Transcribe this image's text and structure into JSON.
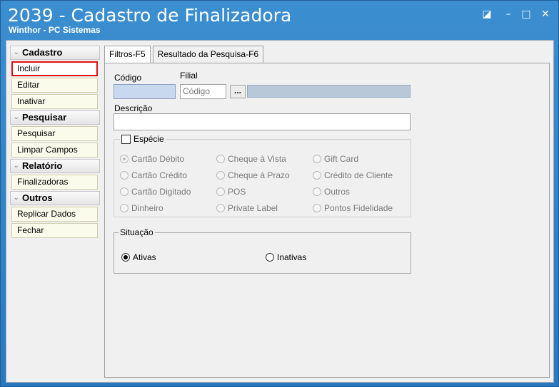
{
  "window": {
    "title": "2039 - Cadastro de Finalizadora",
    "subtitle": "Winthor - PC Sistemas",
    "controls": {
      "restore": "◪",
      "minimize": "–",
      "maximize": "□",
      "close": "✕"
    }
  },
  "menu": {
    "groups": [
      {
        "label": "Cadastro",
        "items": [
          "Incluir",
          "Editar",
          "Inativar"
        ]
      },
      {
        "label": "Pesquisar",
        "items": [
          "Pesquisar",
          "Limpar Campos"
        ]
      },
      {
        "label": "Relatório",
        "items": [
          "Finalizadoras"
        ]
      },
      {
        "label": "Outros",
        "items": [
          "Replicar Dados",
          "Fechar"
        ]
      }
    ],
    "selected": "Incluir"
  },
  "tabs": [
    "Filtros-F5",
    "Resultado da Pesquisa-F6"
  ],
  "form": {
    "codigo_label": "Código",
    "codigo_value": "",
    "filial_label": "Filial",
    "filial_placeholder": "Código",
    "filial_lookup_button": "...",
    "filial_desc_value": "",
    "descricao_label": "Descrição",
    "descricao_value": "",
    "especie": {
      "label": "Espécie",
      "checked": false,
      "options": [
        [
          "Cartão Débito",
          "Cheque à Vista",
          "Gift Card"
        ],
        [
          "Cartão Crédito",
          "Cheque à Prazo",
          "Crédito de Cliente"
        ],
        [
          "Cartão Digitado",
          "POS",
          "Outros"
        ],
        [
          "Dinheiro",
          "Private Label",
          "Pontos Fidelidade"
        ]
      ],
      "selected": "Cartão Débito"
    },
    "situacao": {
      "label": "Situação",
      "options": [
        "Ativas",
        "Inativas"
      ],
      "selected": "Ativas"
    }
  },
  "colors": {
    "titlebar": "#3b8ed0",
    "selected_border": "#e01010",
    "menu_button_bg": "#fbfbec"
  }
}
